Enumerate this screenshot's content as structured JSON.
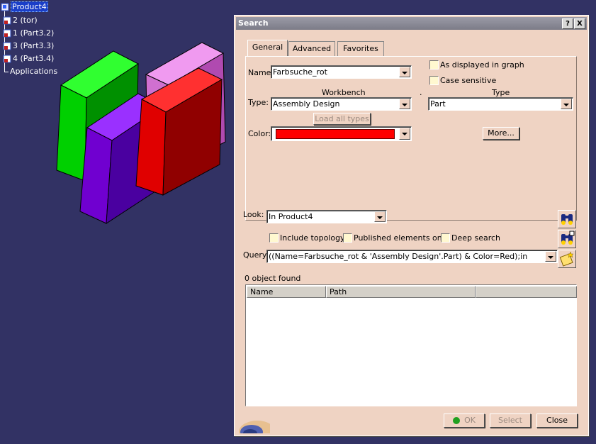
{
  "tree": {
    "root": "Product4",
    "children": [
      "2 (tor)",
      "1 (Part3.2)",
      "3 (Part3.3)",
      "4 (Part3.4)"
    ],
    "applications": "Applications"
  },
  "dialog": {
    "title": "Search",
    "help_btn": "?",
    "close_btn": "X",
    "tabs": [
      "General",
      "Advanced",
      "Favorites"
    ],
    "name_label": "Name:",
    "name_value": "Farbsuche_rot",
    "as_displayed": "As displayed in graph",
    "case_sensitive": "Case sensitive",
    "workbench_header": "Workbench",
    "dot": ".",
    "type_header": "Type",
    "type_label": "Type:",
    "workbench_value": "Assembly Design",
    "type_value": "Part",
    "load_all_types": "Load all types",
    "color_label": "Color:",
    "color_value": "#ff0000",
    "more_btn": "More...",
    "look_label": "Look:",
    "look_value": "In Product4",
    "include_topology": "Include topology",
    "published_only": "Published elements only",
    "deep_search": "Deep search",
    "query_label": "Query:",
    "query_value": "((Name=Farbsuche_rot & 'Assembly Design'.Part) & Color=Red);in",
    "objects_found": "0 object found",
    "col_name": "Name",
    "col_path": "Path",
    "ok_btn": "OK",
    "select_btn": "Select",
    "close_button": "Close"
  },
  "colors": {
    "background": "#323264",
    "dialog": "#efd3c3",
    "green_box": "#00d000",
    "purple_box": "#7000d0",
    "pink_box": "#d070d0",
    "red_box": "#e00000"
  }
}
